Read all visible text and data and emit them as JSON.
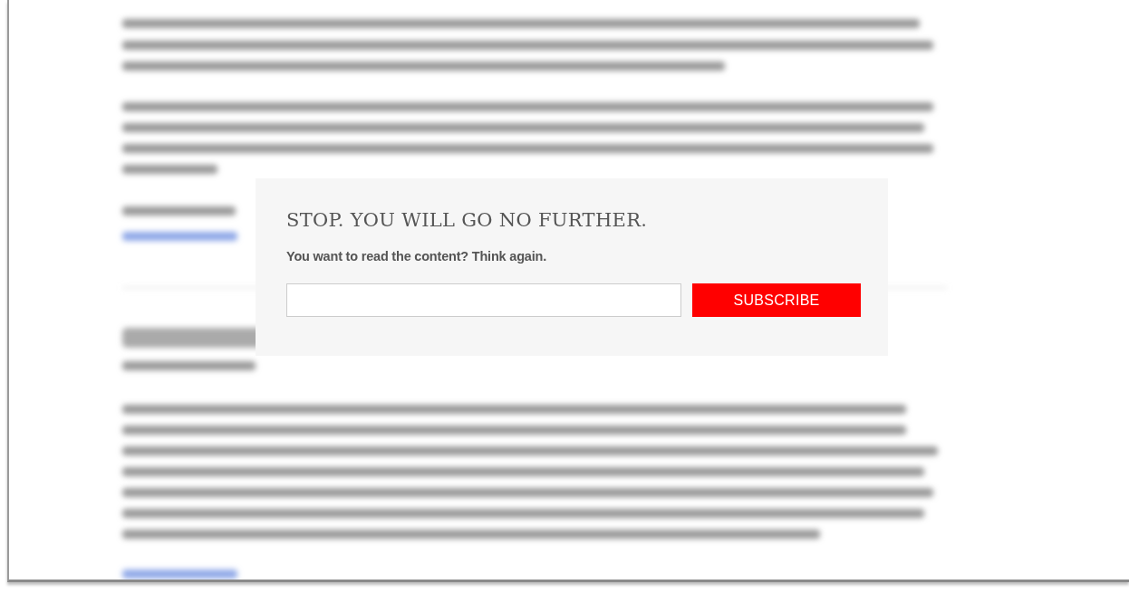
{
  "paywall": {
    "title": "STOP. YOU WILL GO NO FURTHER.",
    "message": "You want to read the content? Think again.",
    "button": "SUBSCRIBE"
  }
}
